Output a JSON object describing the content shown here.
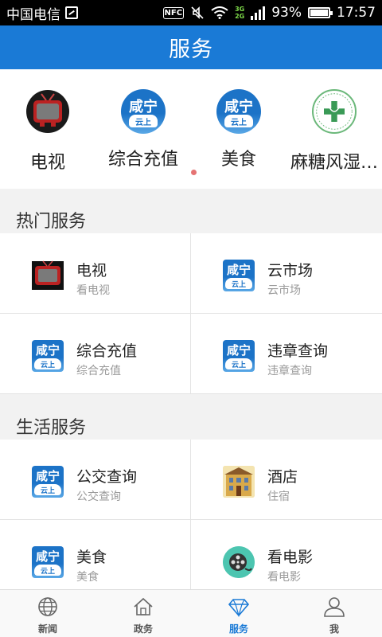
{
  "status_bar": {
    "carrier": "中国电信",
    "nfc": "NFC",
    "net_top": "3G",
    "net_bottom": "2G",
    "battery": "93%",
    "time": "17:57"
  },
  "header": {
    "title": "服务"
  },
  "carousel": {
    "items": [
      {
        "label": "电视",
        "icon": "tv-icon"
      },
      {
        "label": "综合充值",
        "icon": "xianning-cloud-icon"
      },
      {
        "label": "美食",
        "icon": "xianning-cloud-icon"
      },
      {
        "label": "麻糖风湿…",
        "icon": "medical-cross-logo-icon"
      }
    ]
  },
  "logo_text": {
    "city": "咸宁",
    "cloud": "云上"
  },
  "hot": {
    "title": "热门服务",
    "items": [
      {
        "name": "电视",
        "sub": "看电视",
        "icon": "tv-icon"
      },
      {
        "name": "云市场",
        "sub": "云市场",
        "icon": "xianning-cloud-icon"
      },
      {
        "name": "综合充值",
        "sub": "综合充值",
        "icon": "xianning-cloud-icon"
      },
      {
        "name": "违章查询",
        "sub": "违章查询",
        "icon": "xianning-cloud-icon"
      }
    ]
  },
  "life": {
    "title": "生活服务",
    "items": [
      {
        "name": "公交查询",
        "sub": "公交查询",
        "icon": "xianning-cloud-icon"
      },
      {
        "name": "酒店",
        "sub": "住宿",
        "icon": "hotel-icon"
      },
      {
        "name": "美食",
        "sub": "美食",
        "icon": "xianning-cloud-icon"
      },
      {
        "name": "看电影",
        "sub": "看电影",
        "icon": "film-reel-icon"
      }
    ]
  },
  "tabbar": {
    "tabs": [
      {
        "label": "新闻",
        "icon": "globe-icon"
      },
      {
        "label": "政务",
        "icon": "home-icon"
      },
      {
        "label": "服务",
        "icon": "diamond-icon",
        "active": true
      },
      {
        "label": "我",
        "icon": "user-icon"
      }
    ]
  },
  "colors": {
    "primary": "#1a7ad6",
    "page_indicator": "#e57373"
  }
}
